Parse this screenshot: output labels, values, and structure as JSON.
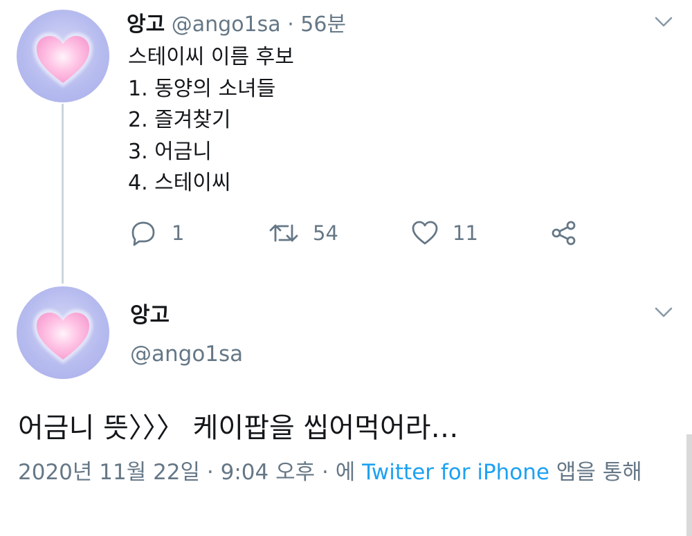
{
  "tweet1": {
    "name": "앙고",
    "handle": "@ango1sa",
    "separator": "·",
    "time": "56분",
    "lines": [
      "스테이씨 이름 후보",
      "1. 동양의 소녀들",
      "2. 즐겨찾기",
      "3. 어금니",
      "4. 스테이씨"
    ],
    "actions": {
      "reply_count": "1",
      "retweet_count": "54",
      "like_count": "11"
    }
  },
  "tweet2": {
    "name": "앙고",
    "handle": "@ango1sa",
    "text": "어금니 뜻〉〉〉 케이팝을 씹어먹어라…",
    "meta": {
      "date": "2020년 11월 22일",
      "sep1": "·",
      "time": "9:04 오후",
      "sep2": "·",
      "prefix": "에",
      "source": "Twitter for iPhone",
      "suffix": "앱을 통해"
    }
  },
  "colors": {
    "text": "#14171a",
    "muted": "#657786",
    "link": "#1da1f2",
    "line": "#ccd6dd",
    "avatar_bg": "#b7bcef",
    "heart": "#ffb6dc"
  },
  "icons": [
    "heart-avatar-icon",
    "chevron-down-icon",
    "reply-icon",
    "retweet-icon",
    "like-icon",
    "share-icon"
  ]
}
